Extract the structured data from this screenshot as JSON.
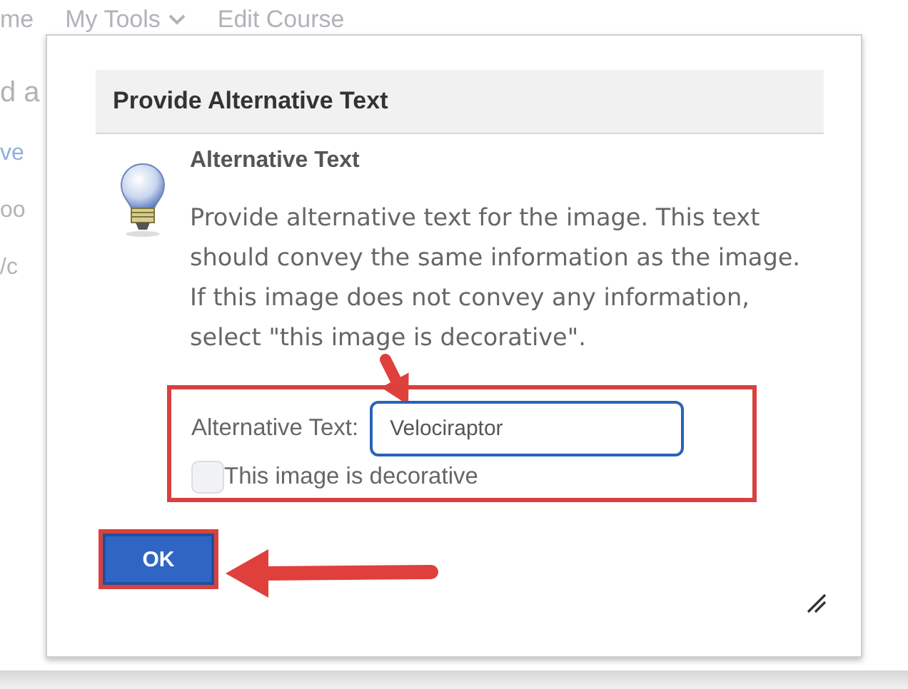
{
  "background": {
    "nav": [
      "me",
      "My Tools",
      "Edit Course"
    ],
    "side": [
      {
        "text": "d a",
        "kind": "heading"
      },
      {
        "text": "ve",
        "kind": "link"
      },
      {
        "text": "oo",
        "kind": "text"
      },
      {
        "text": "/c",
        "kind": "text"
      }
    ]
  },
  "dialog": {
    "title": "Provide Alternative Text",
    "heading": "Alternative Text",
    "description": "Provide alternative text for the image. This text should convey the same information as the image. If this image does not convey any information, select \"this image is decorative\".",
    "field": {
      "label": "Alternative Text:",
      "value": "Velociraptor",
      "focused": true
    },
    "checkbox": {
      "label": "This image is decorative",
      "checked": false
    },
    "buttons": [
      "OK"
    ]
  }
}
